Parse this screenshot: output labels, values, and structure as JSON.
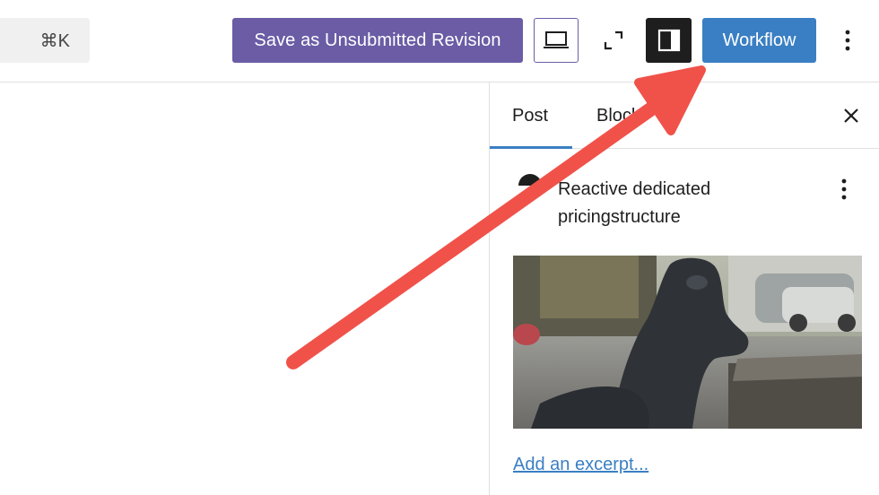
{
  "toolbar": {
    "command_shortcut": "⌘K",
    "save_revision_label": "Save as Unsubmitted Revision",
    "workflow_label": "Workflow",
    "preview_icon": "laptop-icon",
    "fullscreen_icon": "fullscreen-icon",
    "settings_icon": "sidebar-toggle-icon",
    "options_icon": "more-vertical-icon"
  },
  "sidebar": {
    "tabs": [
      {
        "label": "Post",
        "active": true
      },
      {
        "label": "Block",
        "active": false
      }
    ],
    "close_icon": "close-icon",
    "post": {
      "title": "Reactive dedicated pricingstructure",
      "more_icon": "more-vertical-icon"
    },
    "excerpt_link": "Add an excerpt..."
  },
  "colors": {
    "revision_button": "#6b5ca5",
    "workflow_button": "#3a7fc3",
    "settings_button": "#1e1e1e",
    "annotation_arrow": "#f0524a"
  }
}
